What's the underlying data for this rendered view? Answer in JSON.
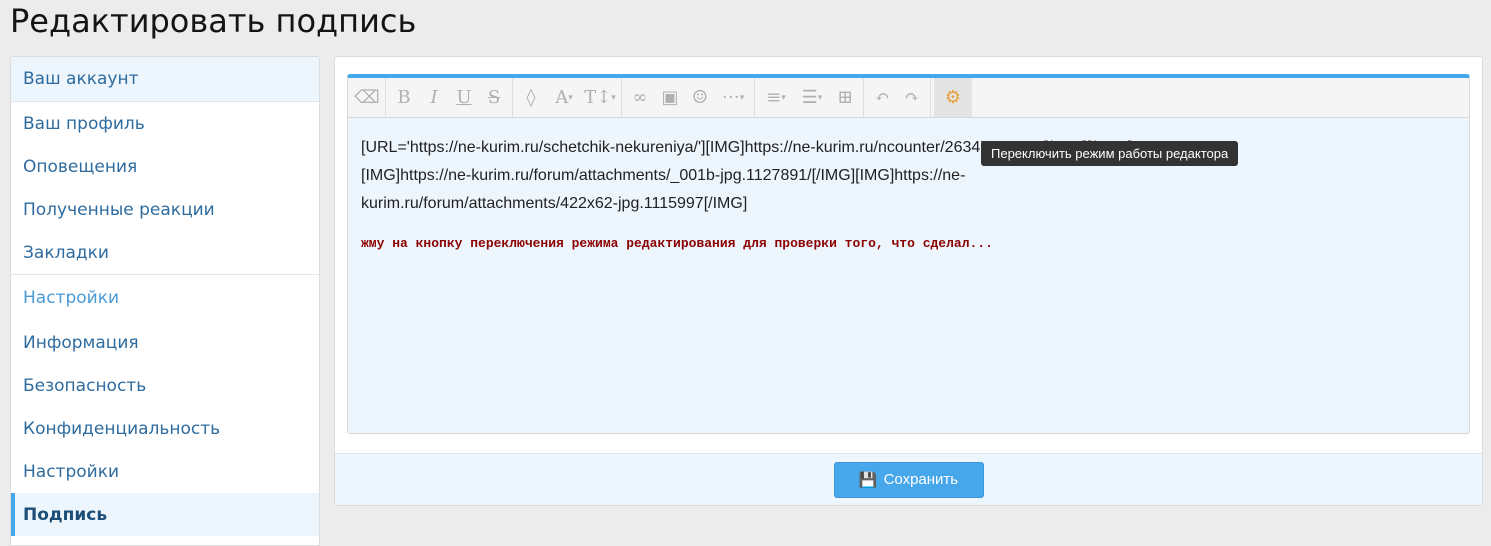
{
  "page": {
    "title": "Редактировать подпись"
  },
  "sidebar": {
    "account_header": "Ваш аккаунт",
    "account_items": [
      "Ваш профиль",
      "Оповещения",
      "Полученные реакции",
      "Закладки"
    ],
    "settings_header": "Настройки",
    "settings_items": [
      "Информация",
      "Безопасность",
      "Конфиденциальность",
      "Настройки",
      "Подпись"
    ]
  },
  "editor": {
    "toolbar": [
      "eraser-icon",
      "bold-icon",
      "italic-icon",
      "underline-icon",
      "strikethrough-icon",
      "color-icon",
      "font-family-icon",
      "font-size-icon",
      "link-icon",
      "image-icon",
      "smiley-icon",
      "more-icon",
      "align-icon",
      "list-icon",
      "table-icon",
      "undo-icon",
      "redo-icon",
      "toggle-mode-icon"
    ],
    "tooltip": "Переключить режим работы редактора",
    "content_lines": [
      "[URL='https://ne-kurim.ru/schetchik-nekureniya/'][IMG]https://ne-kurim.ru/ncounter/263479-8.png[/IMG][/URL]",
      "[IMG]https://ne-kurim.ru/forum/attachments/_001b-jpg.1127891/[/IMG][IMG]https://ne-",
      "kurim.ru/forum/attachments/422x62-jpg.1115997[/IMG]"
    ],
    "note": "жму на кнопку переключения режима редактирования для проверки того, что сделал..."
  },
  "footer": {
    "save_label": "Сохранить"
  },
  "colors": {
    "accent": "#47a7eb",
    "note": "#8b0000",
    "active_icon": "#e8a23a"
  }
}
